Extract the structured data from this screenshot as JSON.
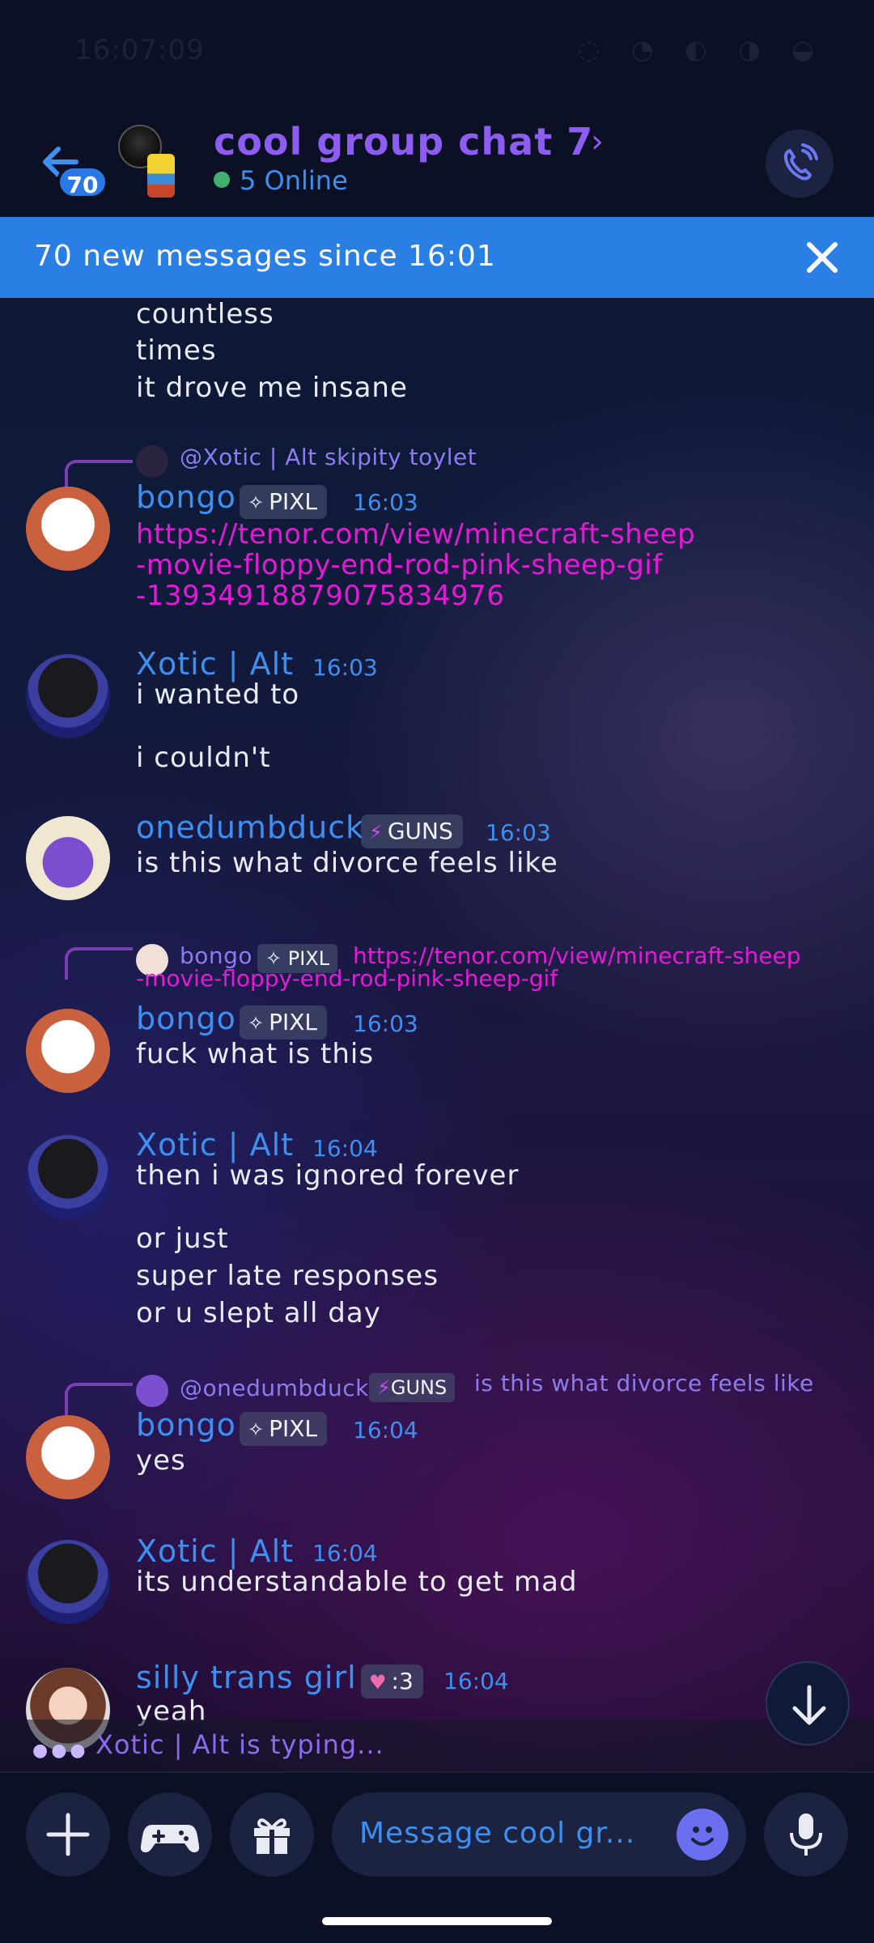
{
  "status_bar": {
    "time": "16:07:09",
    "icons": "◌ ◔ ◐ ◑ ◒"
  },
  "header": {
    "unread_badge": "70",
    "title": "cool group chat 7",
    "chevron": "›",
    "online": "5 Online"
  },
  "banner": {
    "text": "70 new messages since 16:01"
  },
  "messages": {
    "prev_tail": [
      "countless",
      "times",
      "it drove me insane"
    ],
    "m1": {
      "reply": "@Xotic | Alt skipity toylet",
      "author": "bongo",
      "tag": "PIXL",
      "time": "16:03",
      "link_lines": [
        "https://tenor.com/view/minecraft-sheep",
        "-movie-floppy-end-rod-pink-sheep-gif",
        "-13934918879075834976"
      ]
    },
    "m2": {
      "author": "Xotic | Alt",
      "time": "16:03",
      "lines": [
        "i wanted to",
        "i couldn't"
      ]
    },
    "m3": {
      "author": "onedumbduck",
      "tag": "GUNS",
      "time": "16:03",
      "text": "is this what divorce feels like"
    },
    "m4": {
      "reply_author": "bongo",
      "reply_tag": "PIXL",
      "reply_link_1": "https://tenor.com/view/minecraft-sheep",
      "reply_link_2": "-movie-floppy-end-rod-pink-sheep-gif",
      "author": "bongo",
      "tag": "PIXL",
      "time": "16:03",
      "text": "fuck what is this"
    },
    "m5": {
      "author": "Xotic | Alt",
      "time": "16:04",
      "lines": [
        "then i was ignored forever",
        "or just",
        "super late responses",
        "or u slept all day"
      ]
    },
    "m6": {
      "reply_author": "@onedumbduck",
      "reply_tag": "GUNS",
      "reply_text": "is this what divorce feels like",
      "author": "bongo",
      "tag": "PIXL",
      "time": "16:04",
      "text": "yes"
    },
    "m7": {
      "author": "Xotic | Alt",
      "time": "16:04",
      "text": "its understandable to get mad"
    },
    "m8": {
      "author": "silly trans girl",
      "tag": ":3",
      "time": "16:04",
      "text": "yeah"
    }
  },
  "typing": {
    "text": "Xotic | Alt is typing..."
  },
  "composer": {
    "placeholder": "Message cool gr..."
  },
  "colors": {
    "accent": "#2a7fe4",
    "name": "#3d8ff0",
    "title": "#8d5cf0",
    "link": "#e31bd6"
  }
}
